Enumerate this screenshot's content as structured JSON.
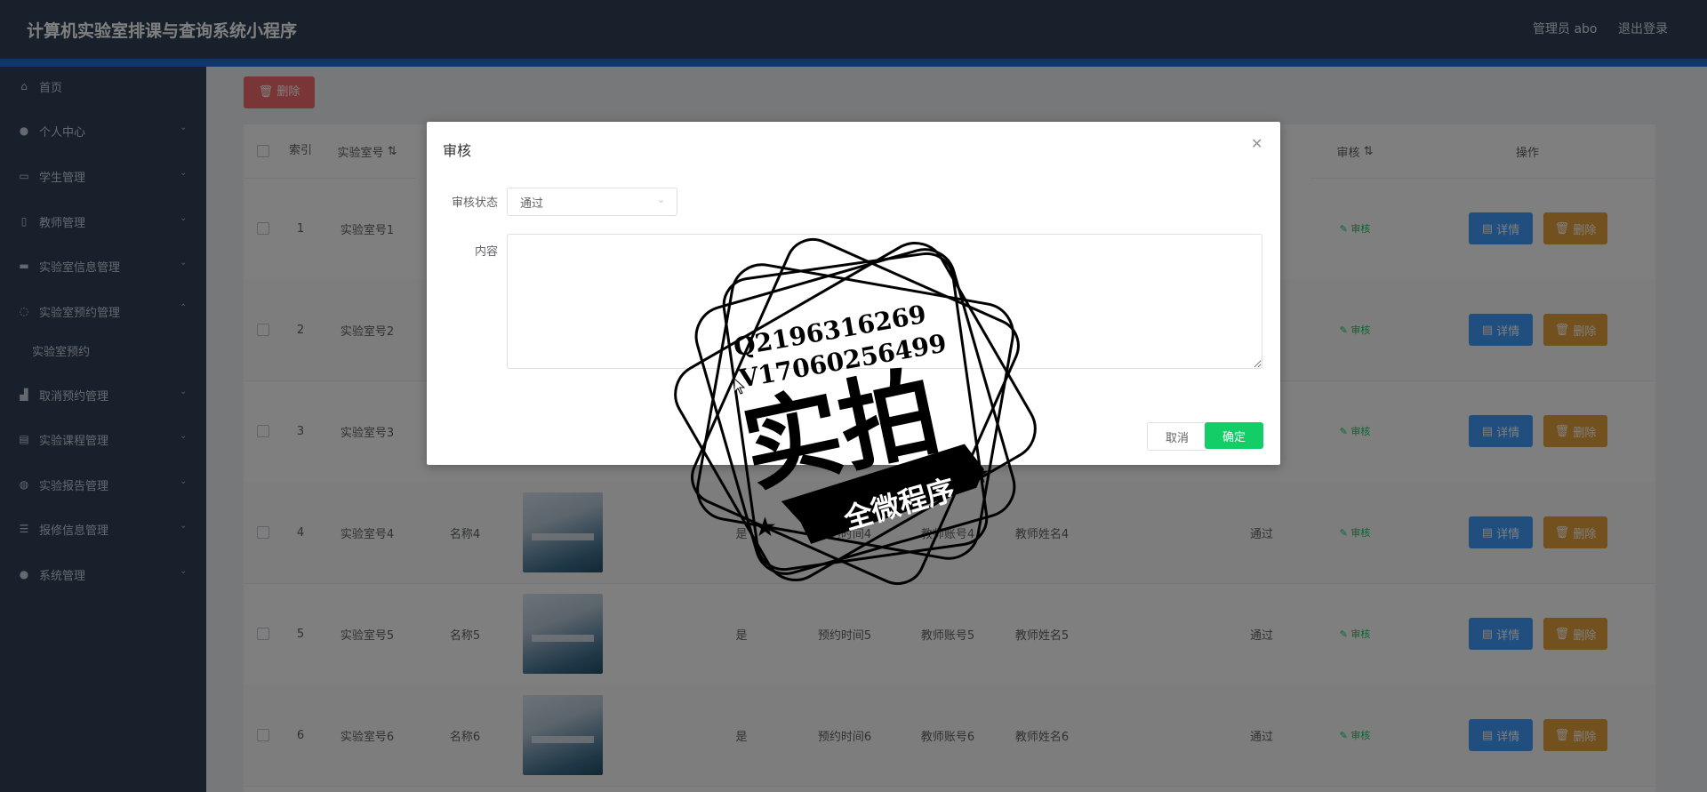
{
  "header": {
    "title": "计算机实验室排课与查询系统小程序",
    "admin": "管理员 abo",
    "logout": "退出登录"
  },
  "sidebar": {
    "items": [
      {
        "label": "首页",
        "icon": "home-icon"
      },
      {
        "label": "个人中心",
        "icon": "user-icon"
      },
      {
        "label": "学生管理",
        "icon": "chat-icon"
      },
      {
        "label": "教师管理",
        "icon": "document-icon"
      },
      {
        "label": "实验室信息管理",
        "icon": "database-icon"
      },
      {
        "label": "实验室预约管理",
        "icon": "microphone-icon"
      },
      {
        "label": "取消预约管理",
        "icon": "chart-icon"
      },
      {
        "label": "实验课程管理",
        "icon": "barcode-icon"
      },
      {
        "label": "实验报告管理",
        "icon": "globe-icon"
      },
      {
        "label": "报修信息管理",
        "icon": "list-icon"
      },
      {
        "label": "系统管理",
        "icon": "user-icon"
      }
    ],
    "sub_item": "实验室预约"
  },
  "toolbar": {
    "delete_label": "删除"
  },
  "table": {
    "headers": {
      "index": "索引",
      "lab_no": "实验室号",
      "audit": "审核",
      "ops": "操作"
    },
    "rows": [
      {
        "idx": "1",
        "lab": "实验室号1",
        "name": "",
        "flag": "",
        "time": "",
        "acct": "",
        "tname": "",
        "status": ""
      },
      {
        "idx": "2",
        "lab": "实验室号2",
        "name": "",
        "flag": "",
        "time": "",
        "acct": "",
        "tname": "",
        "status": ""
      },
      {
        "idx": "3",
        "lab": "实验室号3",
        "name": "",
        "flag": "",
        "time": "",
        "acct": "",
        "tname": "",
        "status": ""
      },
      {
        "idx": "4",
        "lab": "实验室号4",
        "name": "名称4",
        "flag": "是",
        "time": "预约时间4",
        "acct": "教师账号4",
        "tname": "教师姓名4",
        "status": "通过"
      },
      {
        "idx": "5",
        "lab": "实验室号5",
        "name": "名称5",
        "flag": "是",
        "time": "预约时间5",
        "acct": "教师账号5",
        "tname": "教师姓名5",
        "status": "通过"
      },
      {
        "idx": "6",
        "lab": "实验室号6",
        "name": "名称6",
        "flag": "是",
        "time": "预约时间6",
        "acct": "教师账号6",
        "tname": "教师姓名6",
        "status": "通过"
      }
    ],
    "audit_link": "审核",
    "detail_label": "详情",
    "delete_label": "删除"
  },
  "dialog": {
    "title": "审核",
    "status_label": "审核状态",
    "status_value": "通过",
    "content_label": "内容",
    "cancel": "取消",
    "ok": "确定"
  },
  "stamp": {
    "line1": "Q2196316269",
    "line2": "V17060256499",
    "big": "实拍",
    "banner": "全微程序"
  }
}
